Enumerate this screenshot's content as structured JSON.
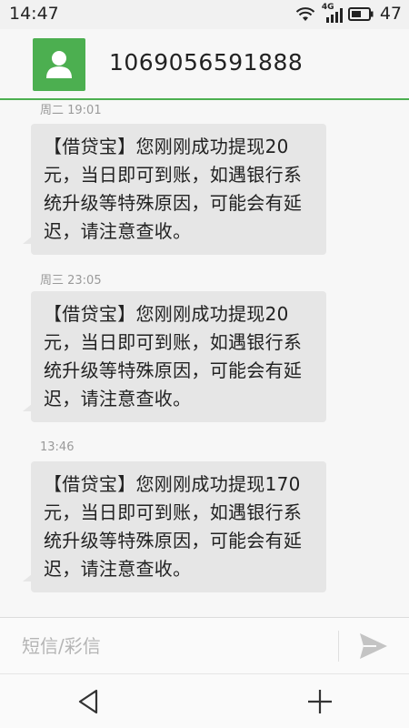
{
  "status_bar": {
    "time": "14:47",
    "network_type": "4G",
    "battery_level": "47",
    "icons": [
      "wifi-icon",
      "signal-icon",
      "battery-icon"
    ]
  },
  "header": {
    "contact_number": "1069056591888",
    "avatar_icon": "person-icon",
    "accent_color": "#4caf50"
  },
  "messages": [
    {
      "timestamp": "周二 19:01",
      "text": "【借贷宝】您刚刚成功提现20元，当日即可到账，如遇银行系统升级等特殊原因，可能会有延迟，请注意查收。"
    },
    {
      "timestamp": "周三 23:05",
      "text": "【借贷宝】您刚刚成功提现20元，当日即可到账，如遇银行系统升级等特殊原因，可能会有延迟，请注意查收。"
    },
    {
      "timestamp": "13:46",
      "text": "【借贷宝】您刚刚成功提现170元，当日即可到账，如遇银行系统升级等特殊原因，可能会有延迟，请注意查收。"
    }
  ],
  "input_bar": {
    "placeholder": "短信/彩信",
    "value": "",
    "send_icon": "send-icon"
  },
  "nav_bar": {
    "back_icon": "back-triangle-icon",
    "add_icon": "plus-icon"
  }
}
